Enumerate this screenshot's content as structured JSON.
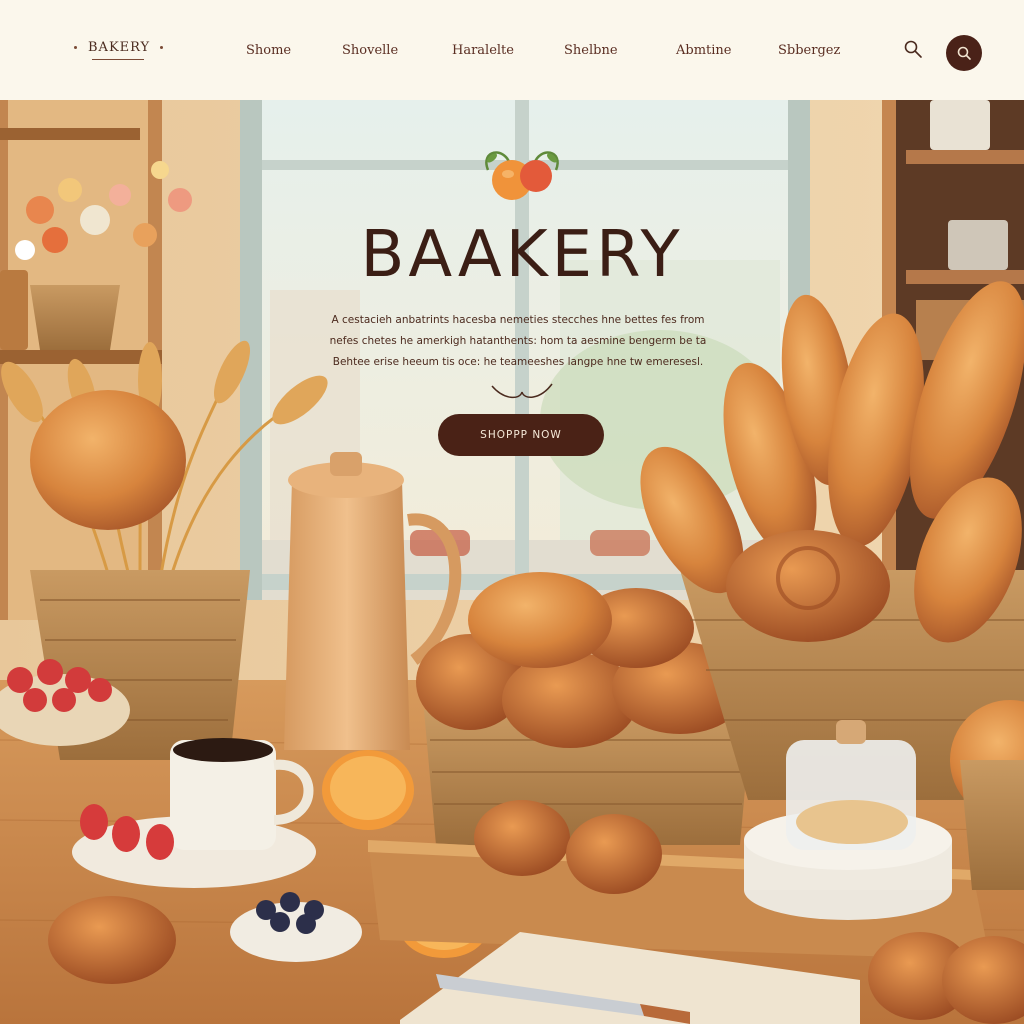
{
  "header": {
    "logo_text": "BAKERY",
    "nav": [
      {
        "label": "Shome"
      },
      {
        "label": "Shovelle"
      },
      {
        "label": "Haralelte"
      },
      {
        "label": "Shelbne"
      },
      {
        "label": "Abmtine"
      },
      {
        "label": "Sbbergez"
      }
    ]
  },
  "hero": {
    "title": "BAAKERY",
    "description_lines": [
      "A cestacieh anbatrints hacesba nemeties stecches hne bettes fes from",
      "nefes chetes he amerkigh hatanthents: hom ta aesmine bengerm be ta",
      "Behtee erise heeum tis oce: he teameeshes langpe hne tw emeresesl."
    ],
    "cta_label": "SHOPPP NOW"
  },
  "colors": {
    "background": "#fbf7ec",
    "brand_dark": "#4a2216",
    "title": "#3b1e15",
    "wood": "#c98a4e"
  }
}
